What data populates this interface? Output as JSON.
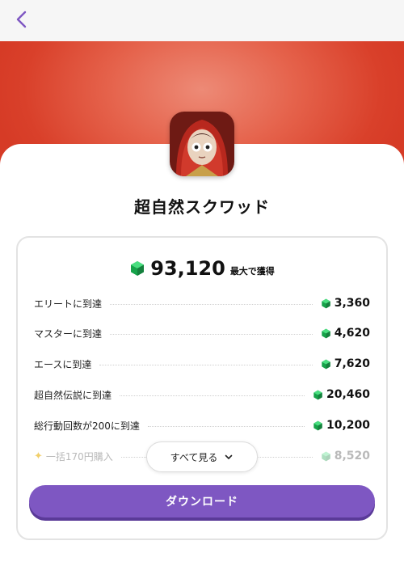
{
  "header": {
    "back_icon": "chevron-left-icon"
  },
  "app": {
    "name": "超自然スクワッド",
    "icon": "game-app-icon"
  },
  "reward": {
    "total": "93,120",
    "caption": "最大で獲得",
    "gem_icon": "green-gem-icon"
  },
  "missions": [
    {
      "label": "エリートに到達",
      "value": "3,360"
    },
    {
      "label": "マスターに到達",
      "value": "4,620"
    },
    {
      "label": "エースに到達",
      "value": "7,620"
    },
    {
      "label": "超自然伝説に到達",
      "value": "20,460"
    },
    {
      "label": "総行動回数が200に到達",
      "value": "10,200"
    }
  ],
  "faded_mission": {
    "label": "一括170円購入",
    "value": "8,520"
  },
  "buttons": {
    "see_all": "すべて見る",
    "download": "ダウンロード"
  },
  "colors": {
    "accent": "#7e57c2",
    "hero": "#e5624b",
    "gem": "#22c55e"
  }
}
